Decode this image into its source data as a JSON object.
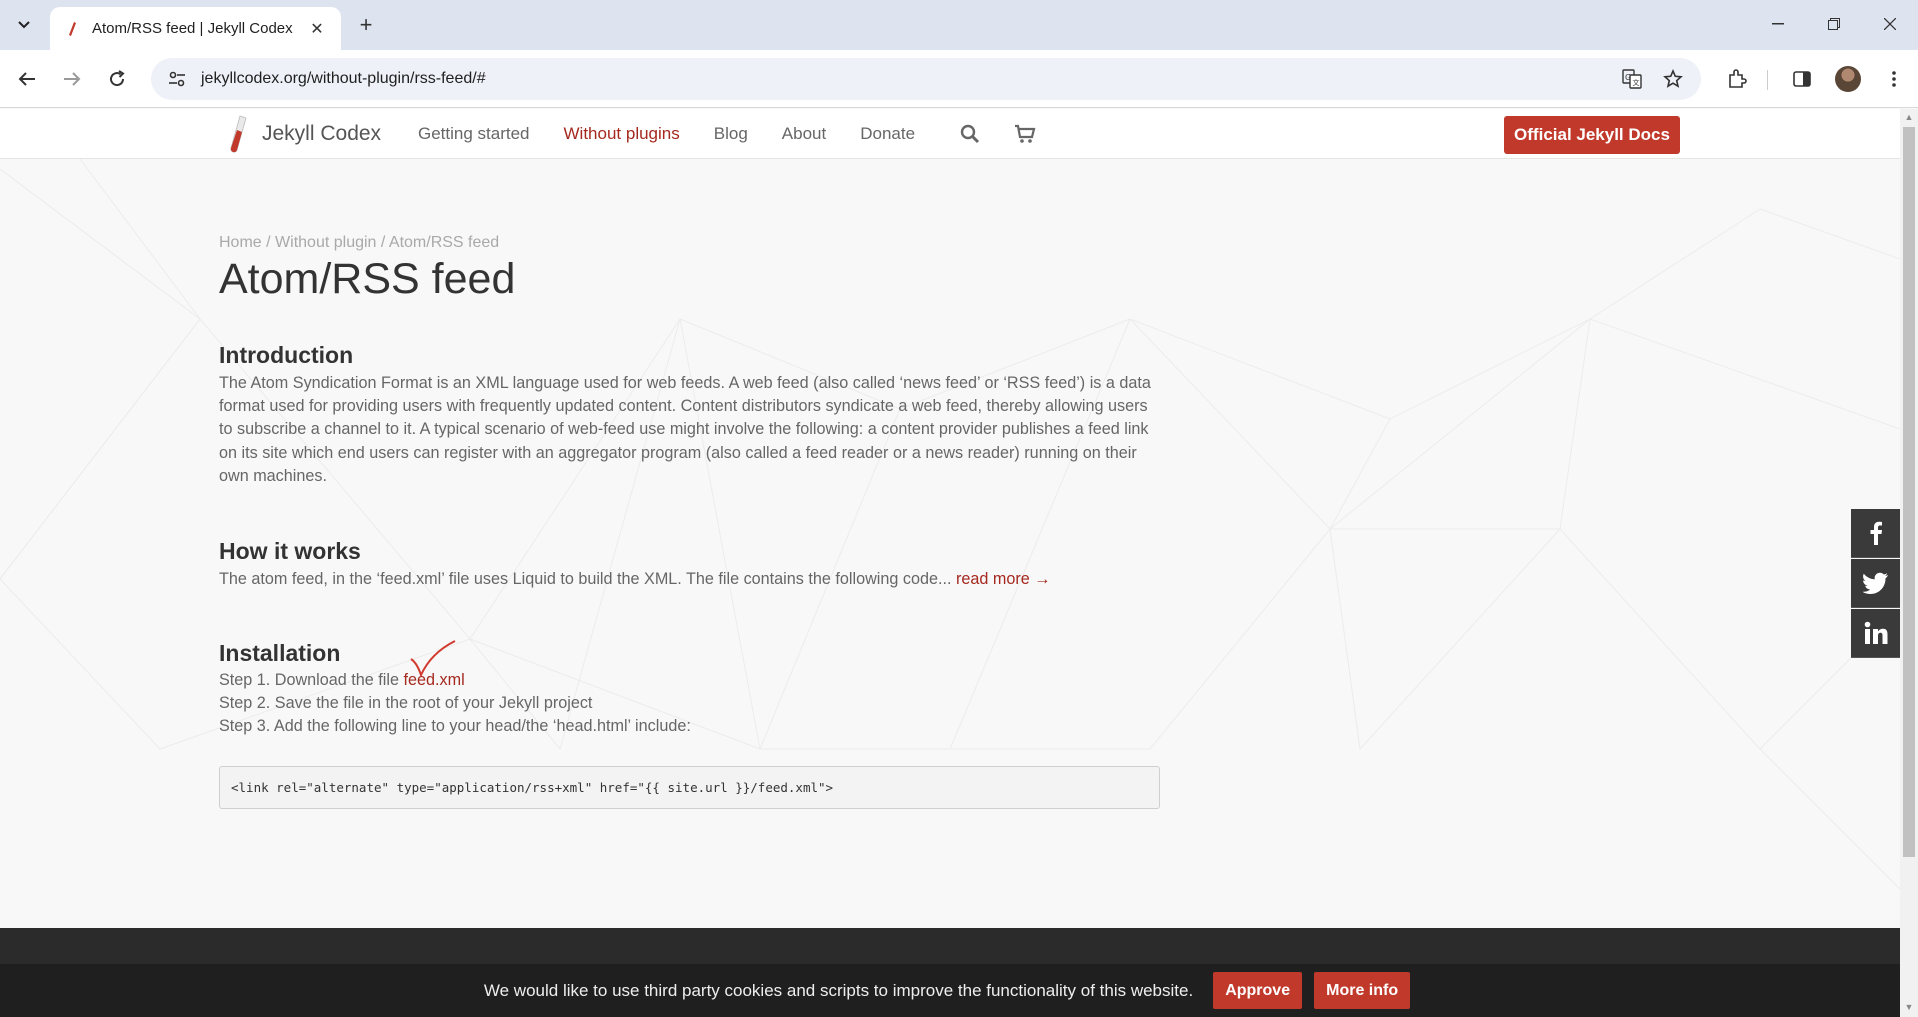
{
  "browser": {
    "tab_title": "Atom/RSS feed | Jekyll Codex",
    "url": "jekyllcodex.org/without-plugin/rss-feed/#"
  },
  "site": {
    "logo_text": "Jekyll Codex",
    "nav": [
      "Getting started",
      "Without plugins",
      "Blog",
      "About",
      "Donate"
    ],
    "docs_button": "Official Jekyll Docs"
  },
  "breadcrumb": {
    "home": "Home",
    "sep": "/",
    "section": "Without plugin",
    "current": "Atom/RSS feed"
  },
  "article": {
    "title": "Atom/RSS feed",
    "intro_heading": "Introduction",
    "intro_text": "The Atom Syndication Format is an XML language used for web feeds. A web feed (also called ‘news feed’ or ‘RSS feed’) is a data format used for providing users with frequently updated content. Content distributors syndicate a web feed, thereby allowing users to subscribe a channel to it. A typical scenario of web-feed use might involve the following: a content provider publishes a feed link on its site which end users can register with an aggregator program (also called a feed reader or a news reader) running on their own machines.",
    "how_heading": "How it works",
    "how_text": "The atom feed, in the ‘feed.xml’ file uses Liquid to build the XML. The file contains the following code...",
    "read_more": "read more →",
    "install_heading": "Installation",
    "step1_prefix": "Step 1. Download the file ",
    "step1_link": "feed.xml",
    "step2": "Step 2. Save the file in the root of your Jekyll project",
    "step3": "Step 3. Add the following line to your head/the ‘head.html’ include:",
    "code": "<link rel=\"alternate\" type=\"application/rss+xml\" href=\"{{ site.url }}/feed.xml\">"
  },
  "cookie": {
    "text": "We would like to use third party cookies and scripts to improve the functionality of this website.",
    "approve": "Approve",
    "more_info": "More info"
  },
  "colors": {
    "accent": "#c0392b",
    "link": "#a5291f"
  }
}
